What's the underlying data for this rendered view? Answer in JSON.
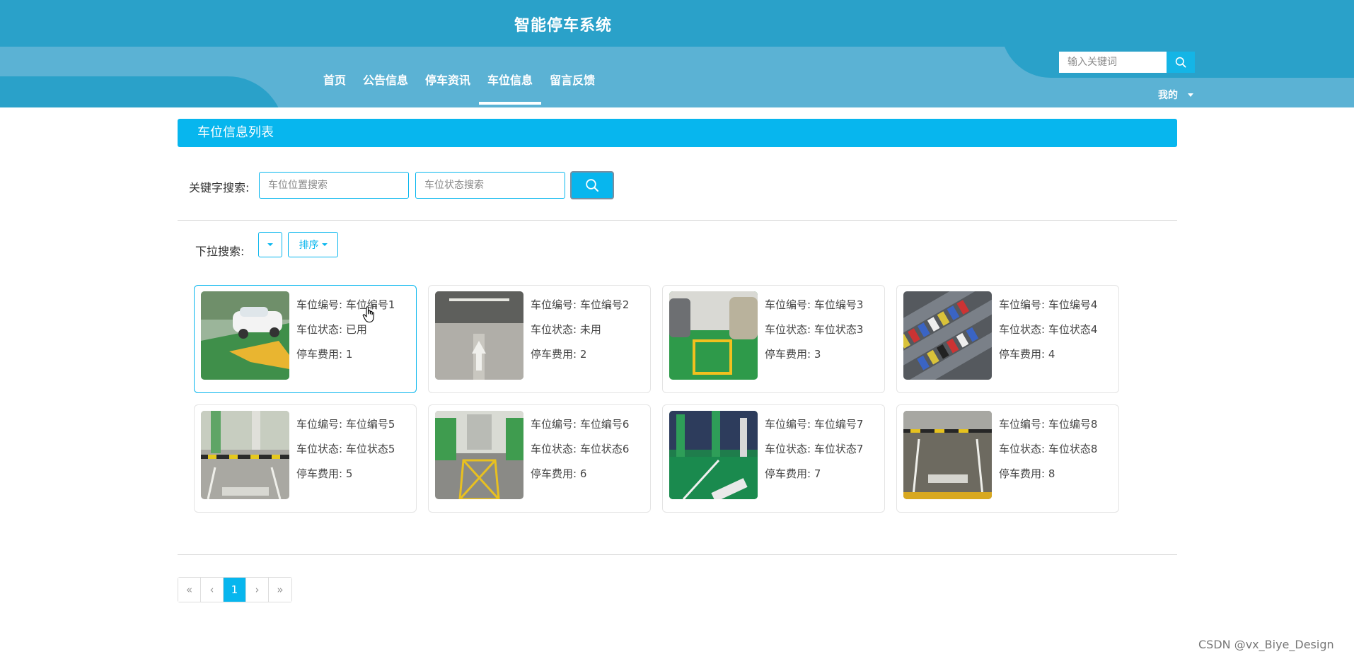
{
  "header": {
    "title": "智能停车系统",
    "nav": [
      {
        "label": "首页"
      },
      {
        "label": "公告信息"
      },
      {
        "label": "停车资讯"
      },
      {
        "label": "车位信息"
      },
      {
        "label": "留言反馈"
      }
    ],
    "active_nav": "车位信息",
    "search_placeholder": "输入关键词",
    "search_icon": "search-icon",
    "mine_label": "我的"
  },
  "main": {
    "section_title": "车位信息列表",
    "keyword_label": "关键字搜索:",
    "location_placeholder": "车位位置搜索",
    "status_placeholder": "车位状态搜索",
    "dropdown_label": "下拉搜索:",
    "sort_label": "排序",
    "field_labels": {
      "number": "车位编号:",
      "status": "车位状态:",
      "fee": "停车费用:"
    },
    "cards": [
      {
        "number": "车位编号1",
        "status": "已用",
        "fee": "1",
        "image": "parking-white-car"
      },
      {
        "number": "车位编号2",
        "status": "未用",
        "fee": "2",
        "image": "parking-garage-arrow"
      },
      {
        "number": "车位编号3",
        "status": "车位状态3",
        "fee": "3",
        "image": "parking-green-spot"
      },
      {
        "number": "车位编号4",
        "status": "车位状态4",
        "fee": "4",
        "image": "parking-aerial-cars"
      },
      {
        "number": "车位编号5",
        "status": "车位状态5",
        "fee": "5",
        "image": "parking-13060"
      },
      {
        "number": "车位编号6",
        "status": "车位状态6",
        "fee": "6",
        "image": "parking-yellow-x"
      },
      {
        "number": "车位编号7",
        "status": "车位状态7",
        "fee": "7",
        "image": "parking-green-floor"
      },
      {
        "number": "车位编号8",
        "status": "车位状态8",
        "fee": "8",
        "image": "parking-f007"
      }
    ]
  },
  "pagination": {
    "first": "«",
    "prev": "‹",
    "current": "1",
    "next": "›",
    "last": "»"
  },
  "watermark": "CSDN @vx_Biye_Design",
  "colors": {
    "header_dark": "#2aa1c9",
    "header_light": "#5bb2d4",
    "accent": "#07b6ee"
  }
}
